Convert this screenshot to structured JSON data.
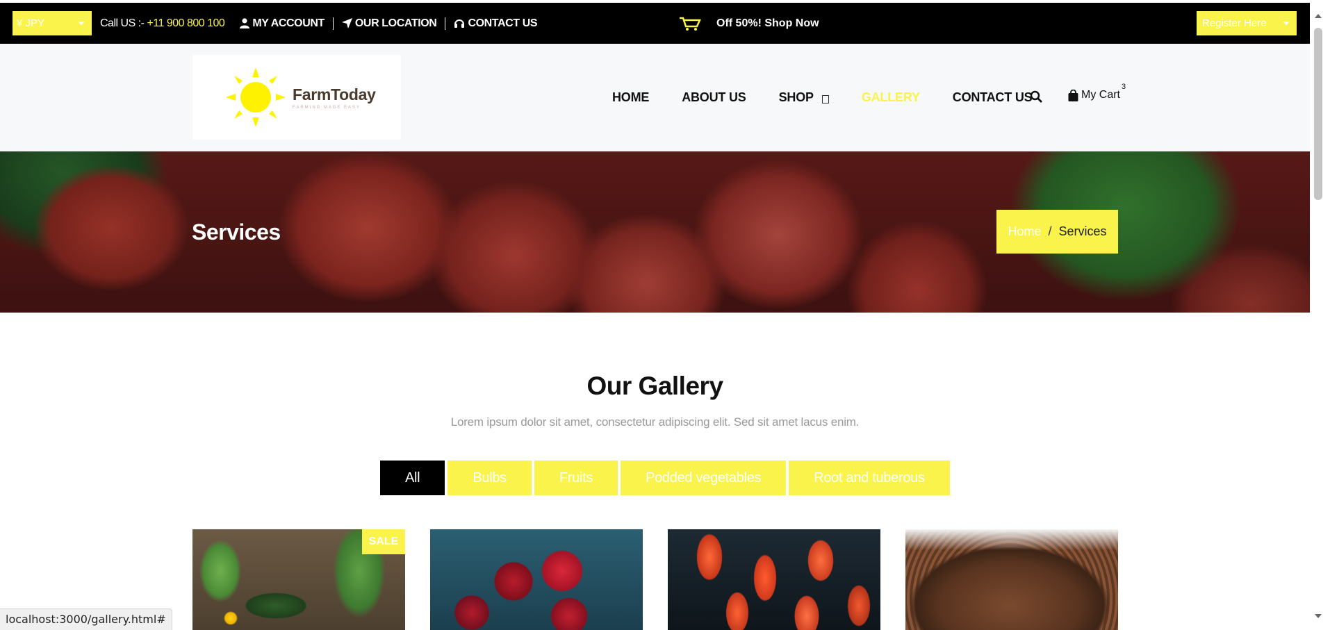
{
  "topbar": {
    "currency": "¥ JPY",
    "call_label": "Call US :-",
    "phone": "+11 900 800 100",
    "links": [
      "MY ACCOUNT",
      "OUR LOCATION",
      "CONTACT US"
    ],
    "promo": "Off 50%! Shop Now",
    "register": "Register Here"
  },
  "header": {
    "logo_name": "FarmToday",
    "logo_tagline": "FARMING MADE EASY",
    "nav": [
      "HOME",
      "ABOUT US",
      "SHOP",
      "GALLERY",
      "CONTACT US"
    ],
    "active_nav": "GALLERY",
    "cart_label": "My Cart",
    "cart_count": "3"
  },
  "banner": {
    "title": "Services",
    "breadcrumb_home": "Home",
    "breadcrumb_sep": "/",
    "breadcrumb_current": "Services"
  },
  "gallery": {
    "title": "Our Gallery",
    "subtitle": "Lorem ipsum dolor sit amet, consectetur adipiscing elit. Sed sit amet lacus enim.",
    "filters": [
      "All",
      "Bulbs",
      "Fruits",
      "Podded vegetables",
      "Root and tuberous"
    ],
    "active_filter": "All",
    "sale_badge": "SALE"
  },
  "status_url": "localhost:3000/gallery.html#",
  "colors": {
    "accent": "#faf34c",
    "topbar_bg": "#000000",
    "header_bg": "#f7f8f9"
  }
}
